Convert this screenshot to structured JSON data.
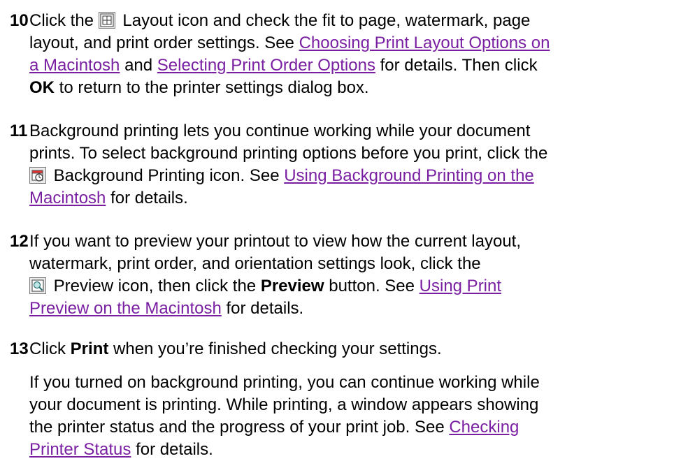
{
  "steps": [
    {
      "number": "10",
      "lines": {
        "l1_a": "Click the",
        "l1_b": "Layout icon and check the fit to page, watermark, page",
        "l2": "layout, and print order settings. See",
        "link1_a": "Choosing Print Layout Options on",
        "link1_b": "a Macintosh",
        "l3_a": "and",
        "link2": "Selecting Print Order Options",
        "l3_b": "for details. Then click",
        "bold_ok": "OK",
        "l4": "to return to the printer settings dialog box."
      },
      "icon": "layout-icon"
    },
    {
      "number": "11",
      "lines": {
        "l1": "Background printing lets you continue working while your document",
        "l2": "prints. To select background printing options before you print, click the",
        "l3_a": "Background Printing icon. See",
        "link1_a": "Using Background Printing on the",
        "link1_b": "Macintosh",
        "l4": "for details."
      },
      "icon": "background-printing-icon"
    },
    {
      "number": "12",
      "lines": {
        "l1": "If you want to preview your printout to view how the current layout,",
        "l2": "watermark, print order, and orientation settings look, click the",
        "l3_a": "Preview icon, then click the",
        "bold_preview": "Preview",
        "l3_b": "button. See",
        "link1_a": "Using Print",
        "link1_b": "Preview on the Macintosh",
        "l4": "for details."
      },
      "icon": "preview-icon"
    },
    {
      "number": "13",
      "lines": {
        "l1_a": "Click",
        "bold_print": "Print",
        "l1_b": "when you’re finished checking your settings.",
        "p2_l1": "If you turned on background printing, you can continue working while",
        "p2_l2": "your document is printing. While printing, a window appears showing",
        "p2_l3": "the printer status and the progress of your print job. See",
        "link1_a": "Checking",
        "link1_b": "Printer Status",
        "p2_l4": "for details."
      }
    }
  ],
  "colors": {
    "link": "#7a1fa2",
    "text": "#000000"
  }
}
